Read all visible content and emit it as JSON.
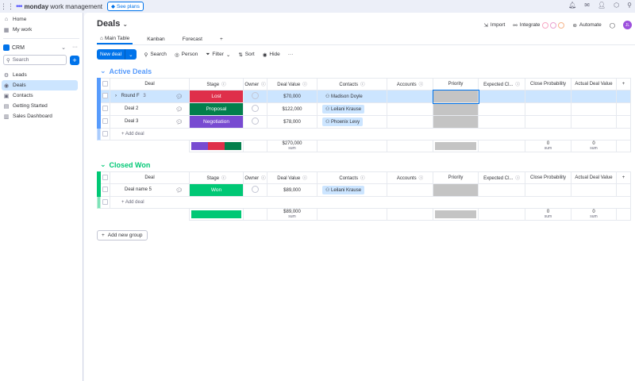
{
  "topbar": {
    "logo_bold": "monday",
    "logo_light": "work management",
    "see_plans": "See plans"
  },
  "sidebar": {
    "home": "Home",
    "my_work": "My work",
    "workspace": "CRM",
    "search_placeholder": "Search",
    "items": [
      {
        "label": "Leads",
        "icon": "leads-icon"
      },
      {
        "label": "Deals",
        "icon": "deals-icon"
      },
      {
        "label": "Contacts",
        "icon": "contacts-icon"
      },
      {
        "label": "Getting Started",
        "icon": "doc-icon"
      },
      {
        "label": "Sales Dashboard",
        "icon": "dashboard-icon"
      }
    ]
  },
  "header": {
    "title": "Deals",
    "import": "Import",
    "integrate": "Integrate",
    "automate": "Automate",
    "avatar_initials": "JL"
  },
  "tabs": [
    "Main Table",
    "Kanban",
    "Forecast"
  ],
  "toolbar": {
    "new_item": "New deal",
    "search": "Search",
    "person": "Person",
    "filter": "Filter",
    "sort": "Sort",
    "hide": "Hide"
  },
  "columns": [
    "Deal",
    "Stage",
    "Owner",
    "Deal Value",
    "Contacts",
    "Accounts",
    "Priority",
    "Expected Cl...",
    "Close Probability",
    "Actual Deal Value"
  ],
  "groups": [
    {
      "name": "Active Deals",
      "color": "#579bfc",
      "rows": [
        {
          "deal": "Round F",
          "subitems": "3",
          "stage": "Lost",
          "stage_color": "#df2f4a",
          "value": "$70,000",
          "contact": "Madison Doyle"
        },
        {
          "deal": "Deal 2",
          "subitems": "",
          "stage": "Proposal",
          "stage_color": "#037f4c",
          "value": "$122,000",
          "contact": "Leilani Krause"
        },
        {
          "deal": "Deal 3",
          "subitems": "",
          "stage": "Negotiation",
          "stage_color": "#784bd1",
          "value": "$78,000",
          "contact": "Phoenix Levy"
        }
      ],
      "add_label": "+ Add deal",
      "sum_value": "$270,000",
      "sum_label": "sum",
      "prob_sum": "0",
      "actual_sum": "0"
    },
    {
      "name": "Closed Won",
      "color": "#00c875",
      "rows": [
        {
          "deal": "Deal name 5",
          "subitems": "",
          "stage": "Won",
          "stage_color": "#00c875",
          "value": "$89,000",
          "contact": "Leilani Krause"
        }
      ],
      "add_label": "+ Add deal",
      "sum_value": "$89,000",
      "sum_label": "sum",
      "prob_sum": "0",
      "actual_sum": "0"
    }
  ],
  "add_group": "Add new group"
}
